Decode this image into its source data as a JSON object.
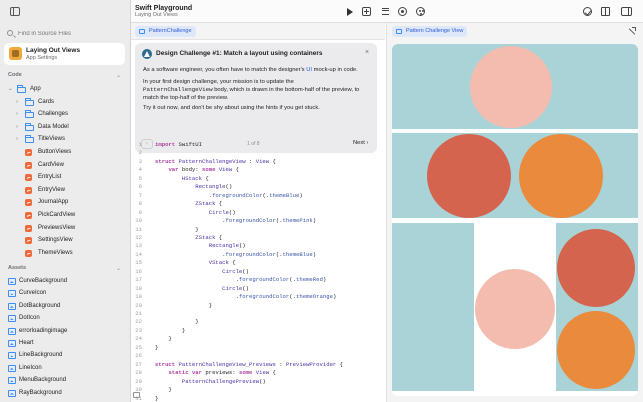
{
  "window": {
    "title": "Swift Playground",
    "subtitle": "Laying Out Views"
  },
  "sidebar": {
    "search_placeholder": "Find in Source Files",
    "project": {
      "name": "Laying Out Views",
      "subtitle": "App Settings"
    },
    "code_heading": "Code",
    "resources_heading": "Assets",
    "code_items": [
      {
        "label": "App",
        "icon": "folder-icon",
        "expanded": true
      },
      {
        "label": "Cards",
        "icon": "folder-icon"
      },
      {
        "label": "Challenges",
        "icon": "folder-icon"
      },
      {
        "label": "Data Model",
        "icon": "folder-icon"
      },
      {
        "label": "TitleViews",
        "icon": "folder-icon"
      },
      {
        "label": "ButtonViews",
        "icon": "swift-file-icon"
      },
      {
        "label": "CardView",
        "icon": "swift-file-icon"
      },
      {
        "label": "EntryList",
        "icon": "swift-file-icon"
      },
      {
        "label": "EntryView",
        "icon": "swift-file-icon"
      },
      {
        "label": "JournalApp",
        "icon": "swift-file-icon"
      },
      {
        "label": "PickCardView",
        "icon": "swift-file-icon"
      },
      {
        "label": "PreviewsView",
        "icon": "swift-file-icon"
      },
      {
        "label": "SettingsView",
        "icon": "swift-file-icon"
      },
      {
        "label": "ThemeViews",
        "icon": "swift-file-icon"
      }
    ],
    "asset_items": [
      {
        "label": "CurveBackground"
      },
      {
        "label": "CurveIcon"
      },
      {
        "label": "DotBackground"
      },
      {
        "label": "DotIcon"
      },
      {
        "label": "errorloadingimage"
      },
      {
        "label": "Heart"
      },
      {
        "label": "LineBackground"
      },
      {
        "label": "LineIcon"
      },
      {
        "label": "MenuBackground"
      },
      {
        "label": "RayBackground"
      }
    ]
  },
  "editor": {
    "tab_label": "PatternChallenge",
    "challenge": {
      "title": "Design Challenge #1: Match a layout using containers",
      "p1_a": "As a software engineer, you often have to match the designer's ",
      "p1_link": "UI",
      "p1_b": " mock-up in code.",
      "p2_a": "In your first design challenge, your mission is to update the",
      "p2_code": "PatternChallengeView",
      "p2_b": " body, which is drawn in the bottom-half of the preview, to",
      "p2_c": "match the top-half of the preview.",
      "p3": "Try it out now, and don't be shy about using the hints if you get stuck.",
      "pager": "1 of 8",
      "next_label": "Next",
      "prev_label": "‹",
      "next_chevron": "›",
      "close_label": "×"
    },
    "code_lines": [
      {
        "n": "1",
        "t": [
          [
            "kw",
            "import"
          ],
          [
            "",
            "SwiftUI"
          ]
        ]
      },
      {
        "n": "2",
        "t": []
      },
      {
        "n": "3",
        "t": [
          [
            "kw",
            "struct"
          ],
          [
            "ty",
            "PatternChallengeView"
          ],
          [
            "",
            " : "
          ],
          [
            "ty",
            "View"
          ],
          [
            "",
            " {"
          ]
        ]
      },
      {
        "n": "4",
        "t": [
          [
            "",
            "    "
          ],
          [
            "kw",
            "var"
          ],
          [
            "",
            " body: "
          ],
          [
            "kw",
            "some"
          ],
          [
            "",
            " "
          ],
          [
            "ty",
            "View"
          ],
          [
            "",
            " {"
          ]
        ]
      },
      {
        "n": "5",
        "t": [
          [
            "",
            "        "
          ],
          [
            "ty",
            "HStack"
          ],
          [
            "",
            " {"
          ]
        ]
      },
      {
        "n": "6",
        "t": [
          [
            "",
            "            "
          ],
          [
            "ty",
            "Rectangle"
          ],
          [
            "",
            "()"
          ]
        ]
      },
      {
        "n": "7",
        "t": [
          [
            "",
            "                ."
          ],
          [
            "md",
            "foregroundColor"
          ],
          [
            "",
            "(."
          ],
          [
            "md",
            "themeBlue"
          ],
          [
            "",
            ")"
          ]
        ]
      },
      {
        "n": "8",
        "t": [
          [
            "",
            "            "
          ],
          [
            "ty",
            "ZStack"
          ],
          [
            "",
            " {"
          ]
        ]
      },
      {
        "n": "9",
        "t": [
          [
            "",
            "                "
          ],
          [
            "ty",
            "Circle"
          ],
          [
            "",
            "()"
          ]
        ]
      },
      {
        "n": "10",
        "t": [
          [
            "",
            "                    ."
          ],
          [
            "md",
            "foregroundColor"
          ],
          [
            "",
            "(."
          ],
          [
            "md",
            "themePink"
          ],
          [
            "",
            ")"
          ]
        ]
      },
      {
        "n": "11",
        "t": [
          [
            "",
            "            }"
          ]
        ]
      },
      {
        "n": "12",
        "t": [
          [
            "",
            "            "
          ],
          [
            "ty",
            "ZStack"
          ],
          [
            "",
            " {"
          ]
        ]
      },
      {
        "n": "13",
        "t": [
          [
            "",
            "                "
          ],
          [
            "ty",
            "Rectangle"
          ],
          [
            "",
            "()"
          ]
        ]
      },
      {
        "n": "14",
        "t": [
          [
            "",
            "                    ."
          ],
          [
            "md",
            "foregroundColor"
          ],
          [
            "",
            "(."
          ],
          [
            "md",
            "themeBlue"
          ],
          [
            "",
            ")"
          ]
        ]
      },
      {
        "n": "15",
        "t": [
          [
            "",
            "                "
          ],
          [
            "ty",
            "VStack"
          ],
          [
            "",
            " {"
          ]
        ]
      },
      {
        "n": "16",
        "t": [
          [
            "",
            "                    "
          ],
          [
            "ty",
            "Circle"
          ],
          [
            "",
            "()"
          ]
        ]
      },
      {
        "n": "17",
        "t": [
          [
            "",
            "                        ."
          ],
          [
            "md",
            "foregroundColor"
          ],
          [
            "",
            "(."
          ],
          [
            "md",
            "themeRed"
          ],
          [
            "",
            ")"
          ]
        ]
      },
      {
        "n": "18",
        "t": [
          [
            "",
            "                    "
          ],
          [
            "ty",
            "Circle"
          ],
          [
            "",
            "()"
          ]
        ]
      },
      {
        "n": "19",
        "t": [
          [
            "",
            "                        ."
          ],
          [
            "md",
            "foregroundColor"
          ],
          [
            "",
            "(."
          ],
          [
            "md",
            "themeOrange"
          ],
          [
            "",
            ")"
          ]
        ]
      },
      {
        "n": "20",
        "t": [
          [
            "",
            "                }"
          ]
        ]
      },
      {
        "n": "21",
        "t": []
      },
      {
        "n": "22",
        "t": [
          [
            "",
            "            }"
          ]
        ]
      },
      {
        "n": "23",
        "t": [
          [
            "",
            "        }"
          ]
        ]
      },
      {
        "n": "24",
        "t": [
          [
            "",
            "    }"
          ]
        ]
      },
      {
        "n": "25",
        "t": [
          [
            "",
            "}"
          ]
        ]
      },
      {
        "n": "26",
        "t": []
      },
      {
        "n": "27",
        "t": [
          [
            "kw",
            "struct"
          ],
          [
            "ty",
            "PatternChallengeView_Previews"
          ],
          [
            "",
            " : "
          ],
          [
            "ty",
            "PreviewProvider"
          ],
          [
            "",
            " {"
          ]
        ]
      },
      {
        "n": "28",
        "t": [
          [
            "",
            "    "
          ],
          [
            "kw",
            "static"
          ],
          [
            "",
            " "
          ],
          [
            "kw",
            "var"
          ],
          [
            "",
            " previews: "
          ],
          [
            "kw",
            "some"
          ],
          [
            "",
            " "
          ],
          [
            "ty",
            "View"
          ],
          [
            "",
            " {"
          ]
        ]
      },
      {
        "n": "29",
        "t": [
          [
            "",
            "        "
          ],
          [
            "ty",
            "PatternChallengePreview"
          ],
          [
            "",
            "()"
          ]
        ]
      },
      {
        "n": "30",
        "t": [
          [
            "",
            "    }"
          ]
        ]
      },
      {
        "n": "31",
        "t": [
          [
            "",
            "}"
          ]
        ]
      }
    ]
  },
  "preview": {
    "tab_label": "Pattern Challenge View",
    "colors": {
      "themeBlue": "#a9d3d6",
      "themePink": "#f3bcaf",
      "themeRed": "#d4644e",
      "themeOrange": "#ea8a3c",
      "white": "#ffffff"
    }
  }
}
